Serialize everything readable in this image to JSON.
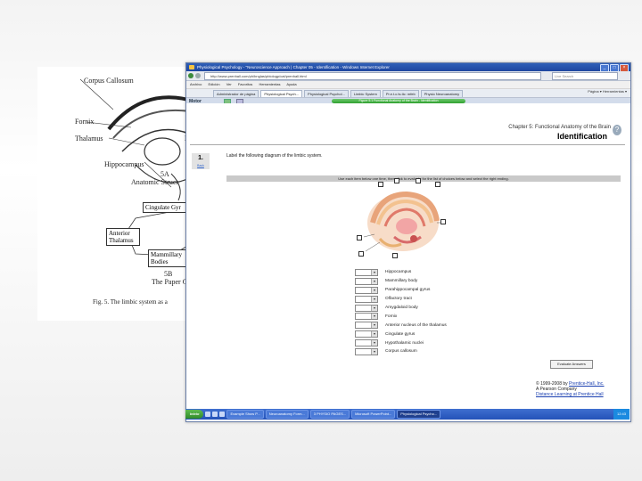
{
  "scan": {
    "labels": [
      "Corpus Callosum",
      "Fornix",
      "Thalamus",
      "M",
      "Hippocampus",
      "5A",
      "Anatomic Struct"
    ],
    "boxes": [
      "Cingulate Gyr",
      "Anterior Thalamus",
      "Mammillary Bodies"
    ],
    "labels2": [
      "5B",
      "The Paper Ci"
    ],
    "caption": "Fig. 5.  The limbic system as a"
  },
  "window": {
    "title": "Physiological Psychology - \"Neuroscience Approach | Chapter 05 - Identification - Windows Internet Explorer",
    "address": "http://www.prenhall.com/ph/bnglas/pbiologp/cat/prenhall.html",
    "search_placeholder": "Live Search",
    "menu": [
      "Archivo",
      "Edición",
      "Ver",
      "Favoritos",
      "Herramientas",
      "Ayuda"
    ],
    "tabs": [
      "Administrador de página",
      "Physiological Psych...",
      "Physiological Psychol...",
      "Limbic System",
      "Pr.e.t.c.ts.tic: mfeb",
      "Physio Neuroanatomy"
    ],
    "right_cmds": "Página ▾   Herramientas ▾",
    "toolbar_label": "Motor",
    "progress_text": "Figure 5.1 Functional Anatomy of the Brain - Identification"
  },
  "page": {
    "chapter": "Chapter 5: Functional Anatomy of the Brain",
    "section": "Identification",
    "question_number": "1.",
    "question_sub": "Back",
    "instruction": "Label the following diagram of the limbic system.",
    "bar_text": "Use each item below one time, then click to evaluate for the list of choices below and select the right ending.",
    "callout_count": 8,
    "answer_options": [
      "Hippocampus",
      "Mammillary body",
      "Parahippocampal gyrus",
      "Olfactory tract",
      "Amygdaloid body",
      "Fornix",
      "Anterior nucleus of the thalamus",
      "Cingulate gyrus",
      "Hypothalamic nuclei",
      "Corpus callosum"
    ],
    "evaluate_button": "Evaluate Answers",
    "copyright": "© 1999-2008 by",
    "publisher_link": "Prentice-Hall, Inc.",
    "company": "A Pearson Company",
    "legal_link": "Distance Learning at Prentice Hall"
  },
  "taskbar": {
    "start": "Inicio",
    "tasks": [
      "Example Show P...",
      "Neuroanatomy Form...",
      "3 PHYSIO PAGES...",
      "Microsoft PowerPoint...",
      "Physiological Psycho..."
    ],
    "active_index": 4,
    "clock": "12:43"
  },
  "colors": {
    "title_bar": "#2452b8",
    "progress_green": "#2fa02f",
    "link_blue": "#1a3fb0"
  }
}
